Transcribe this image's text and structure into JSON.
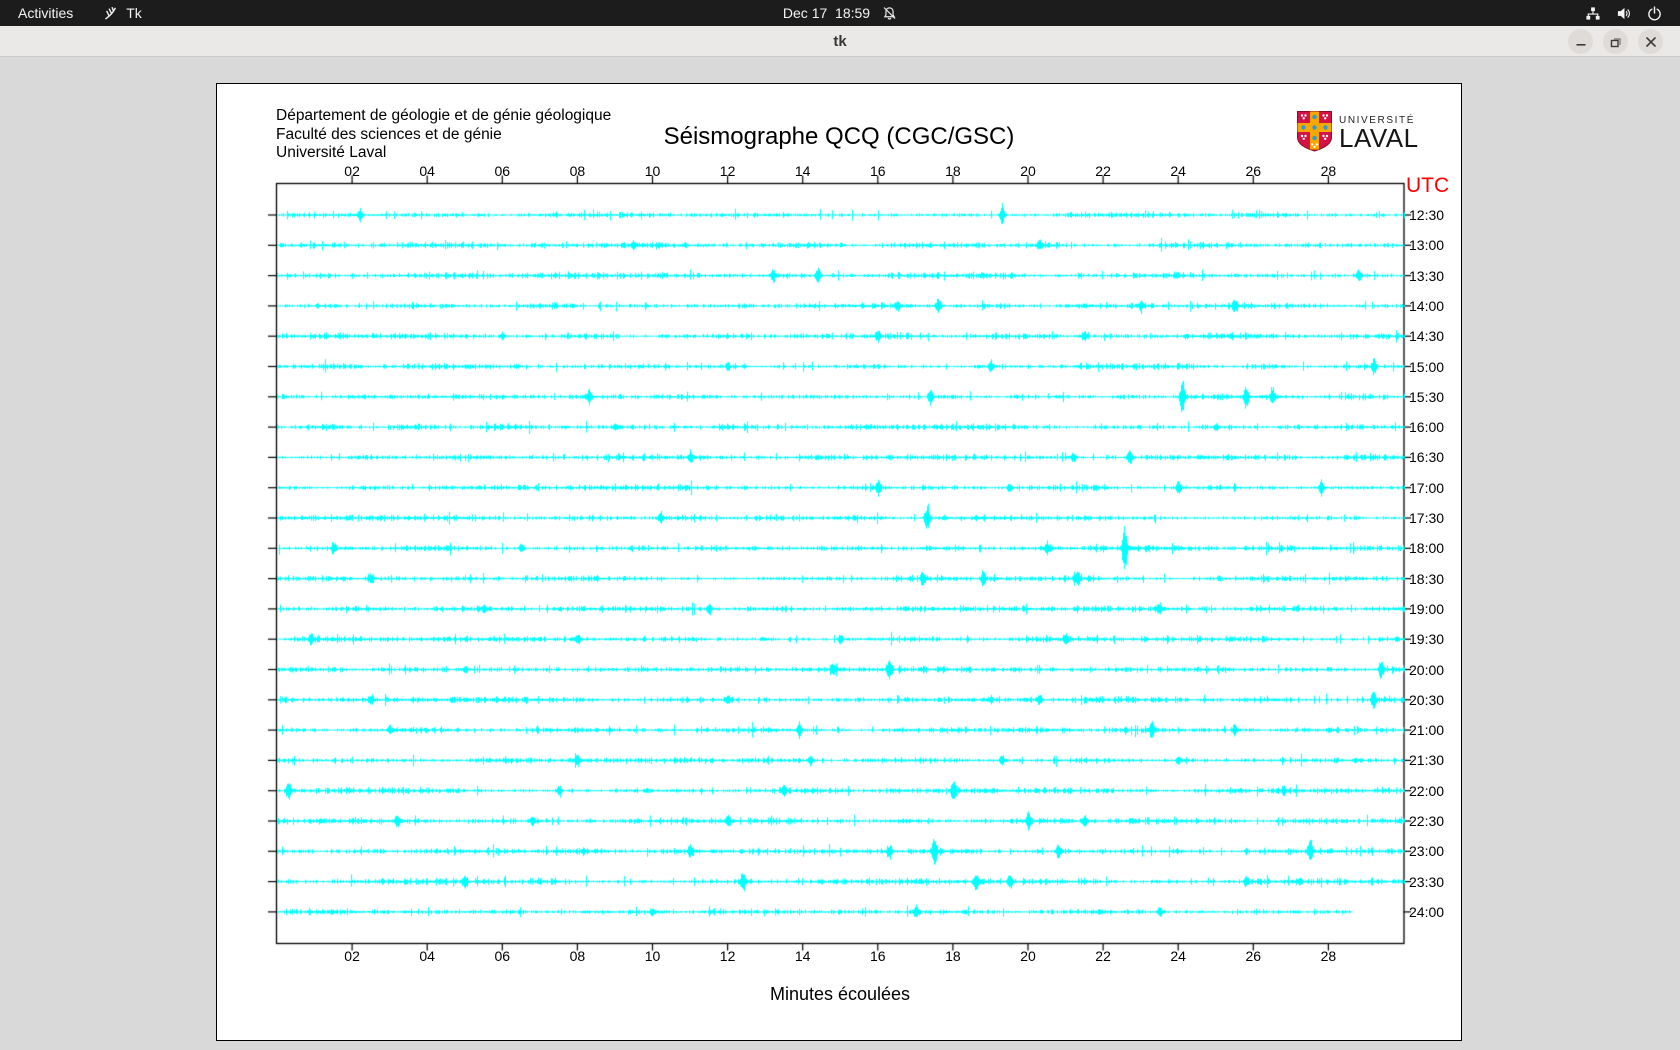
{
  "topbar": {
    "activities_label": "Activities",
    "app_name": "Tk",
    "clock": "Dec 17  18:59",
    "icons": [
      "tk-feather-icon",
      "notifications-off-icon",
      "network-icon",
      "volume-icon",
      "power-icon"
    ]
  },
  "titlebar": {
    "title": "tk",
    "buttons": [
      "minimize",
      "restore",
      "close"
    ]
  },
  "panel": {
    "header_lines": [
      "Département de géologie et de génie géologique",
      "Faculté des sciences et de génie",
      "Université Laval"
    ],
    "title": "Séismographe QCQ (CGC/GSC)",
    "logo": {
      "line1": "UNIVERSITÉ",
      "line2": "LAVAL"
    },
    "utc_header": "UTC",
    "xlabel": "Minutes écoulées"
  },
  "chart_data": {
    "type": "seismogram-helicorder",
    "title": "Séismographe QCQ (CGC/GSC)",
    "xlabel": "Minutes écoulées",
    "x_ticks": [
      "02",
      "04",
      "06",
      "08",
      "10",
      "12",
      "14",
      "16",
      "18",
      "20",
      "22",
      "24",
      "26",
      "28"
    ],
    "x_range_minutes": [
      0,
      30
    ],
    "minutes_per_tick": 2,
    "trace_color": "#00ffff",
    "axis_color": "#000000",
    "utc_header": "UTC",
    "utc_header_color": "#ff0000",
    "rows": [
      {
        "utc": "12:30",
        "end_min": 30,
        "events": [
          [
            2.2,
            4
          ],
          [
            19.3,
            7
          ]
        ]
      },
      {
        "utc": "13:00",
        "end_min": 30,
        "events": [
          [
            9.5,
            3
          ],
          [
            20.3,
            4
          ]
        ]
      },
      {
        "utc": "13:30",
        "end_min": 30,
        "events": [
          [
            13.2,
            4
          ],
          [
            14.4,
            6
          ],
          [
            28.8,
            5
          ]
        ]
      },
      {
        "utc": "14:00",
        "end_min": 30,
        "events": [
          [
            16.5,
            4
          ],
          [
            17.6,
            6
          ],
          [
            23.0,
            4
          ],
          [
            25.5,
            4
          ]
        ]
      },
      {
        "utc": "14:30",
        "end_min": 30,
        "events": [
          [
            6.0,
            3
          ],
          [
            16.0,
            4
          ],
          [
            21.5,
            4
          ]
        ]
      },
      {
        "utc": "15:00",
        "end_min": 30,
        "events": [
          [
            12.0,
            3
          ],
          [
            19.0,
            4
          ],
          [
            29.2,
            6
          ]
        ]
      },
      {
        "utc": "15:30",
        "end_min": 30,
        "events": [
          [
            8.3,
            5
          ],
          [
            17.4,
            7
          ],
          [
            24.1,
            13
          ],
          [
            25.8,
            9
          ],
          [
            26.5,
            7
          ]
        ]
      },
      {
        "utc": "16:00",
        "end_min": 30,
        "events": [
          [
            9.0,
            3
          ],
          [
            25.0,
            3
          ]
        ]
      },
      {
        "utc": "16:30",
        "end_min": 30,
        "events": [
          [
            11.0,
            4
          ],
          [
            21.2,
            4
          ],
          [
            22.7,
            6
          ]
        ]
      },
      {
        "utc": "17:00",
        "end_min": 30,
        "events": [
          [
            16.0,
            6
          ],
          [
            19.5,
            4
          ],
          [
            24.0,
            5
          ],
          [
            27.8,
            5
          ]
        ]
      },
      {
        "utc": "17:30",
        "end_min": 30,
        "events": [
          [
            10.2,
            4
          ],
          [
            17.3,
            9
          ]
        ]
      },
      {
        "utc": "18:00",
        "end_min": 30,
        "events": [
          [
            1.5,
            4
          ],
          [
            6.5,
            4
          ],
          [
            20.5,
            5
          ],
          [
            22.56,
            18
          ]
        ]
      },
      {
        "utc": "18:30",
        "end_min": 30,
        "events": [
          [
            2.5,
            4
          ],
          [
            17.2,
            5
          ],
          [
            18.8,
            6
          ],
          [
            21.3,
            5
          ]
        ]
      },
      {
        "utc": "19:00",
        "end_min": 30,
        "events": [
          [
            5.5,
            3
          ],
          [
            11.5,
            4
          ],
          [
            23.5,
            4
          ]
        ]
      },
      {
        "utc": "19:30",
        "end_min": 30,
        "events": [
          [
            0.9,
            5
          ],
          [
            8.0,
            4
          ],
          [
            15.0,
            4
          ],
          [
            21.0,
            4
          ]
        ]
      },
      {
        "utc": "20:00",
        "end_min": 30,
        "events": [
          [
            5.0,
            3
          ],
          [
            14.8,
            5
          ],
          [
            16.3,
            6
          ],
          [
            29.4,
            6
          ]
        ]
      },
      {
        "utc": "20:30",
        "end_min": 30,
        "events": [
          [
            2.5,
            4
          ],
          [
            12.0,
            4
          ],
          [
            20.3,
            4
          ],
          [
            29.2,
            7
          ]
        ]
      },
      {
        "utc": "21:00",
        "end_min": 30,
        "events": [
          [
            3.0,
            3
          ],
          [
            13.9,
            5
          ],
          [
            23.3,
            6
          ],
          [
            25.5,
            4
          ]
        ]
      },
      {
        "utc": "21:30",
        "end_min": 30,
        "events": [
          [
            8.0,
            4
          ],
          [
            14.2,
            3
          ],
          [
            19.3,
            4
          ],
          [
            24.0,
            4
          ]
        ]
      },
      {
        "utc": "22:00",
        "end_min": 30,
        "events": [
          [
            0.3,
            7
          ],
          [
            7.5,
            4
          ],
          [
            13.5,
            4
          ],
          [
            18.0,
            8
          ],
          [
            26.8,
            4
          ]
        ]
      },
      {
        "utc": "22:30",
        "end_min": 30,
        "events": [
          [
            3.2,
            5
          ],
          [
            6.8,
            4
          ],
          [
            12.0,
            4
          ],
          [
            20.0,
            5
          ],
          [
            21.5,
            5
          ]
        ]
      },
      {
        "utc": "23:00",
        "end_min": 30,
        "events": [
          [
            11.0,
            5
          ],
          [
            16.3,
            5
          ],
          [
            17.5,
            12
          ],
          [
            20.8,
            6
          ],
          [
            27.5,
            7
          ]
        ]
      },
      {
        "utc": "23:30",
        "end_min": 30,
        "events": [
          [
            5.0,
            4
          ],
          [
            12.4,
            7
          ],
          [
            18.6,
            6
          ],
          [
            19.5,
            6
          ],
          [
            25.8,
            4
          ]
        ]
      },
      {
        "utc": "24:00",
        "end_min": 28.6,
        "events": [
          [
            10.0,
            3
          ],
          [
            17.0,
            5
          ],
          [
            23.5,
            4
          ]
        ]
      }
    ]
  }
}
